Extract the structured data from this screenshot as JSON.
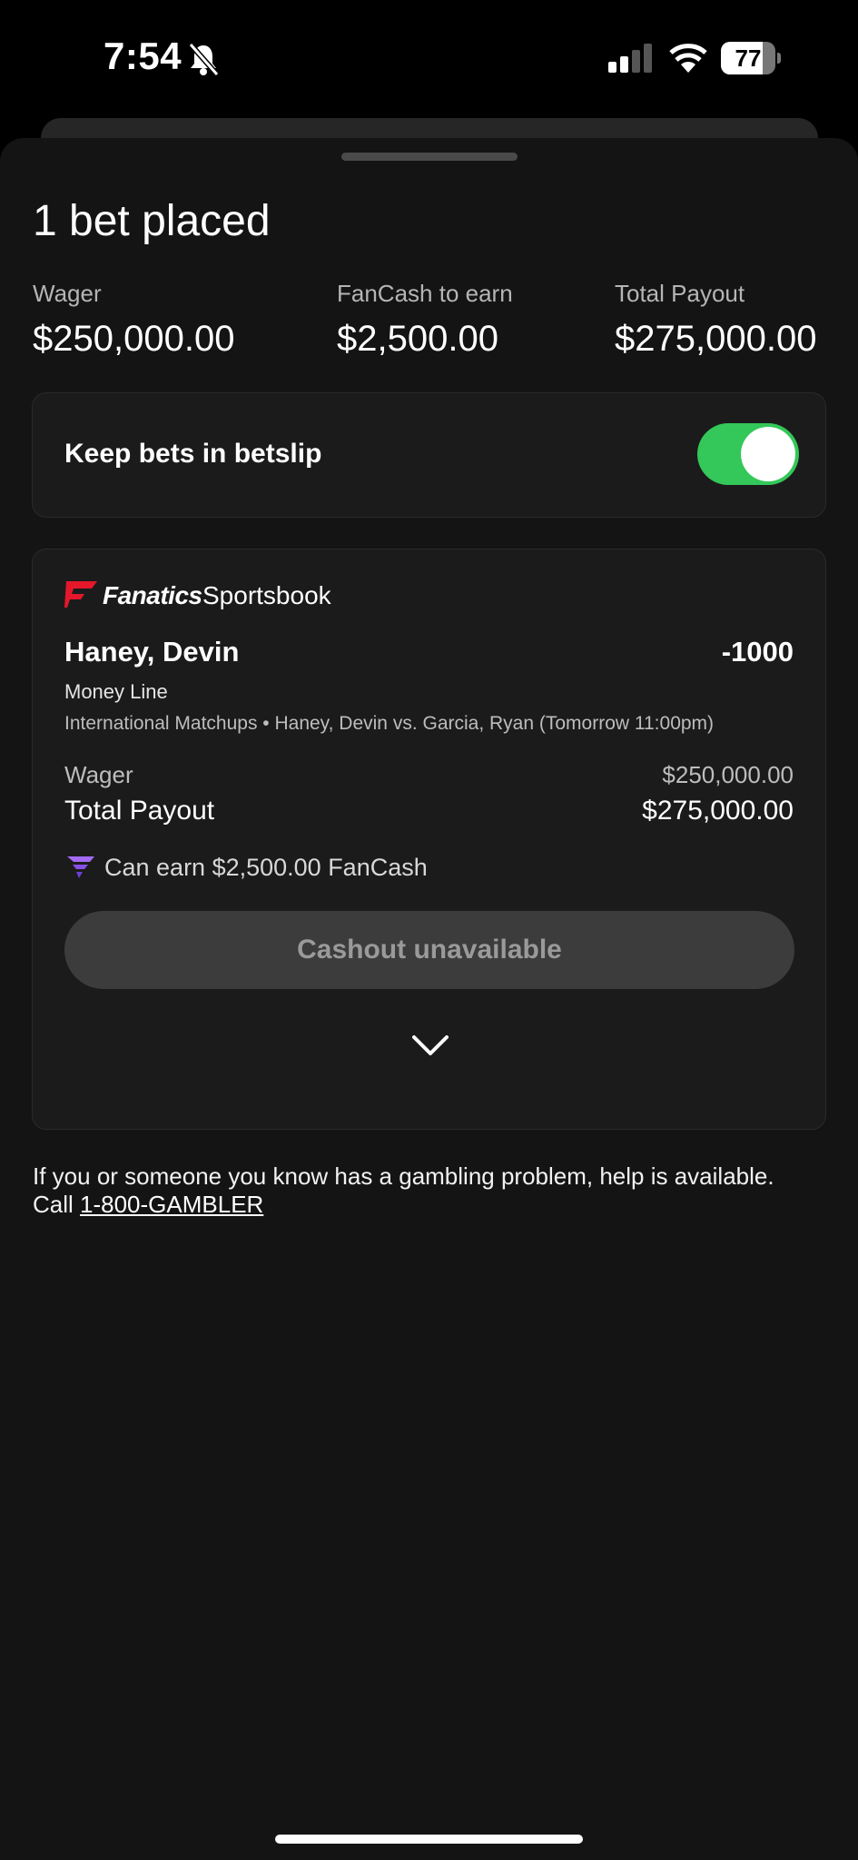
{
  "status_bar": {
    "time": "7:54",
    "battery": "77",
    "battery_level": 0.77
  },
  "sheet": {
    "title": "1 bet placed",
    "summary": [
      {
        "label": "Wager",
        "value": "$250,000.00"
      },
      {
        "label": "FanCash to earn",
        "value": "$2,500.00"
      },
      {
        "label": "Total Payout",
        "value": "$275,000.00"
      }
    ],
    "keep_bets": {
      "label": "Keep bets in betslip",
      "enabled": true
    }
  },
  "bet": {
    "brand": "Fanatics",
    "brand_suffix": "Sportsbook",
    "selection": "Haney, Devin",
    "odds": "-1000",
    "market": "Money Line",
    "event": "International Matchups • Haney, Devin vs. Garcia, Ryan (Tomorrow 11:00pm)",
    "wager_label": "Wager",
    "wager_value": "$250,000.00",
    "payout_label": "Total Payout",
    "payout_value": "$275,000.00",
    "fancash_text": "Can earn $2,500.00 FanCash",
    "cashout_label": "Cashout unavailable"
  },
  "footer": {
    "disclaimer": "If you or someone you know has a gambling problem, help is available.",
    "call_prefix": "Call ",
    "helpline": "1-800-GAMBLER"
  },
  "colors": {
    "toggle_on": "#34c759",
    "brand_red": "#e4172b",
    "fancash_purple": "#a46bf5"
  }
}
